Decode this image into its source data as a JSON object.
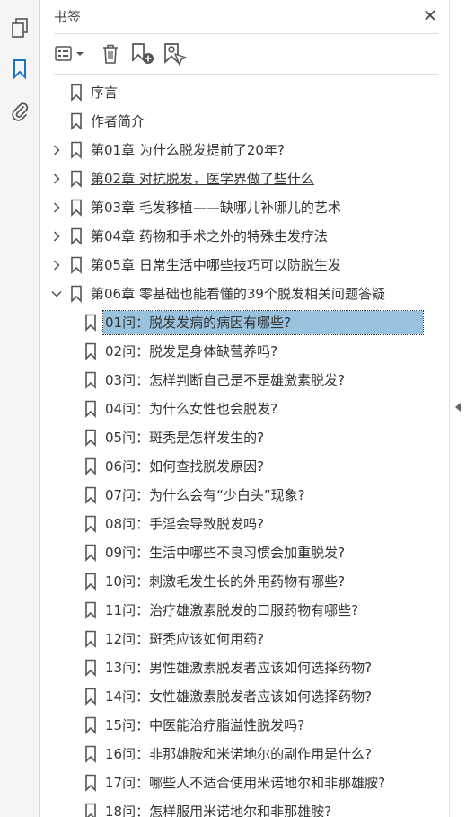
{
  "panel": {
    "title": "书签"
  },
  "left_rail": {
    "icons": [
      "pages-icon",
      "bookmark-icon",
      "attachment-icon"
    ]
  },
  "toolbar": {
    "icons": [
      "options-menu-icon",
      "delete-icon",
      "new-bookmark-icon",
      "bookmark-search-icon"
    ]
  },
  "colors": {
    "selection": "#99c2df",
    "accent": "#1a73c7",
    "icon": "#555555"
  },
  "bookmarks": [
    {
      "label": "序言",
      "level": 0,
      "expander": "none"
    },
    {
      "label": "作者简介",
      "level": 0,
      "expander": "none"
    },
    {
      "label": "第01章 为什么脱发提前了20年?",
      "level": 0,
      "expander": "collapsed"
    },
    {
      "label": "第02章 对抗脱发，医学界做了些什么",
      "level": 0,
      "expander": "collapsed",
      "underlined": true
    },
    {
      "label": "第03章 毛发移植——缺哪儿补哪儿的艺术",
      "level": 0,
      "expander": "collapsed"
    },
    {
      "label": "第04章 药物和手术之外的特殊生发疗法",
      "level": 0,
      "expander": "collapsed"
    },
    {
      "label": "第05章 日常生活中哪些技巧可以防脱生发",
      "level": 0,
      "expander": "collapsed"
    },
    {
      "label": "第06章 零基础也能看懂的39个脱发相关问题答疑",
      "level": 0,
      "expander": "expanded"
    },
    {
      "label": "01问：脱发发病的病因有哪些?",
      "level": 1,
      "expander": "none",
      "selected": true
    },
    {
      "label": "02问：脱发是身体缺营养吗?",
      "level": 1,
      "expander": "none"
    },
    {
      "label": "03问：怎样判断自己是不是雄激素脱发?",
      "level": 1,
      "expander": "none"
    },
    {
      "label": "04问：为什么女性也会脱发?",
      "level": 1,
      "expander": "none"
    },
    {
      "label": "05问：斑秃是怎样发生的?",
      "level": 1,
      "expander": "none"
    },
    {
      "label": "06问：如何查找脱发原因?",
      "level": 1,
      "expander": "none"
    },
    {
      "label": "07问：为什么会有“少白头”现象?",
      "level": 1,
      "expander": "none"
    },
    {
      "label": "08问：手淫会导致脱发吗?",
      "level": 1,
      "expander": "none"
    },
    {
      "label": "09问：生活中哪些不良习惯会加重脱发?",
      "level": 1,
      "expander": "none"
    },
    {
      "label": "10问：刺激毛发生长的外用药物有哪些?",
      "level": 1,
      "expander": "none"
    },
    {
      "label": "11问：治疗雄激素脱发的口服药物有哪些?",
      "level": 1,
      "expander": "none"
    },
    {
      "label": "12问：斑秃应该如何用药?",
      "level": 1,
      "expander": "none"
    },
    {
      "label": "13问：男性雄激素脱发者应该如何选择药物?",
      "level": 1,
      "expander": "none"
    },
    {
      "label": "14问：女性雄激素脱发者应该如何选择药物?",
      "level": 1,
      "expander": "none"
    },
    {
      "label": "15问：中医能治疗脂溢性脱发吗?",
      "level": 1,
      "expander": "none"
    },
    {
      "label": "16问：非那雄胺和米诺地尔的副作用是什么?",
      "level": 1,
      "expander": "none"
    },
    {
      "label": "17问：哪些人不适合使用米诺地尔和非那雄胺?",
      "level": 1,
      "expander": "none"
    },
    {
      "label": "18问：怎样服用米诺地尔和非那雄胺?",
      "level": 1,
      "expander": "none"
    }
  ]
}
